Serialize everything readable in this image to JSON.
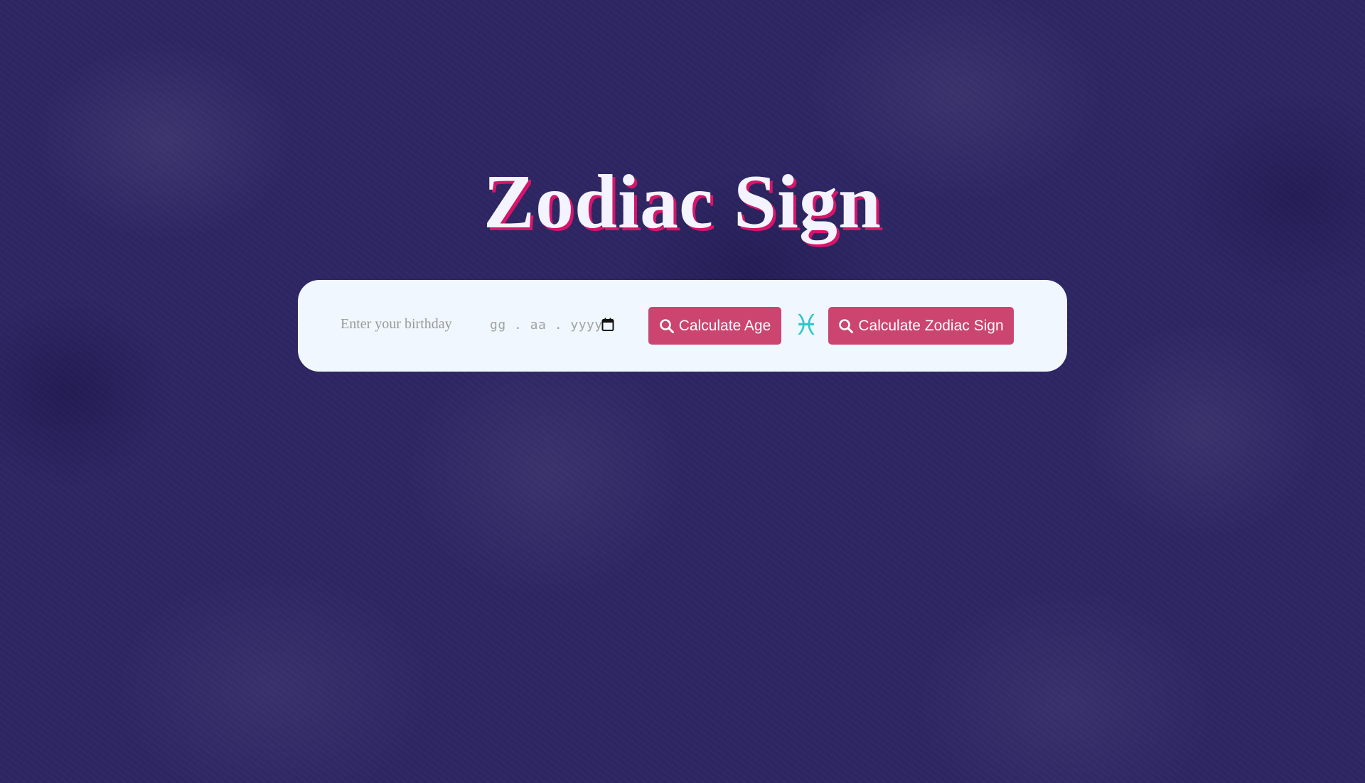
{
  "page": {
    "title": "Zodiac Sign"
  },
  "form": {
    "birthday_label": "Enter your birthday",
    "date_placeholder": "gg . aa . yyyy",
    "calculate_age_label": "Calculate Age",
    "calculate_zodiac_label": "Calculate Zodiac Sign",
    "zodiac_symbol": "♓",
    "icons": {
      "date_picker": "calendar-icon",
      "age_button": "search-icon",
      "zodiac_button": "search-icon",
      "zodiac_sign": "pisces-icon"
    }
  },
  "colors": {
    "background": "#2e2663",
    "panel": "#f0f7fe",
    "button": "#cc4470",
    "title_shadow": "#d6156a",
    "zodiac_symbol": "#2ec7c9"
  }
}
